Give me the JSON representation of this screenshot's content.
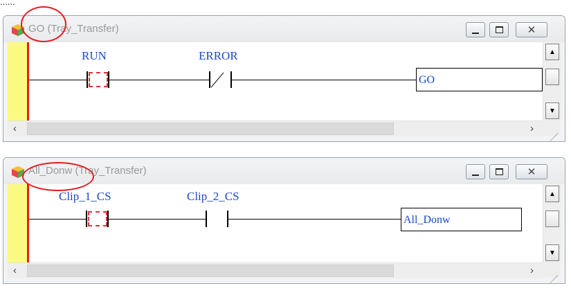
{
  "window_1": {
    "title": "GO (Tray_Transfer)",
    "contact_1_label": "RUN",
    "contact_2_label": "ERROR",
    "coil_label": "GO"
  },
  "window_2": {
    "title": "All_Donw (Tray_Transfer)",
    "contact_1_label": "Clip_1_CS",
    "contact_2_label": "Clip_2_CS",
    "coil_label": "All_Donw"
  },
  "window_controls": {
    "minimize": "minimize",
    "maximize": "maximize",
    "close": "✕"
  },
  "scrollbar": {
    "up_arrow": "▲",
    "down_arrow": "▼",
    "left_arrow": "‹",
    "right_arrow": "›"
  },
  "colors": {
    "power_rail": "#fafa82",
    "rail_line": "#ee1a1a",
    "label_blue": "#1a49c8",
    "annotation_circle": "#e51c23"
  }
}
